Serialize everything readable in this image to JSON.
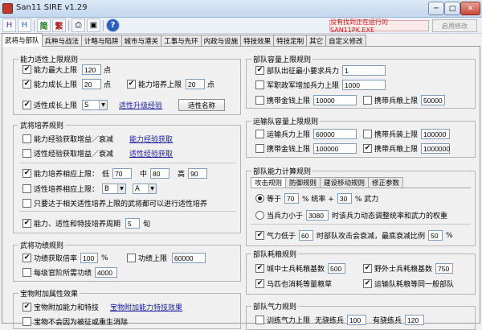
{
  "window": {
    "title": "San11 SIRE v1.29",
    "minimize": "─",
    "maximize": "□",
    "close": "✕"
  },
  "toolbar": {
    "buttons": [
      "H",
      "H",
      "简",
      "繁",
      "⎙",
      "▣",
      "?"
    ],
    "warning": "没有找到正在运行的SAN11PK.EXE",
    "apply_button": "启用修改"
  },
  "tabs": [
    "武将与部队",
    "兵种与战法",
    "计略与陷阱",
    "城市与港关",
    "工事与先环",
    "内政与设施",
    "特技效果",
    "特技定制",
    "其它",
    "自定义修改"
  ],
  "ability_upper": {
    "title": "能力适性上限规则",
    "max_upper_label": "能力最大上限",
    "max_upper_value": "120",
    "unit_pt": "点",
    "growth_upper_label": "能力成长上限",
    "growth_upper_value": "20",
    "train_upper_label": "能力培养上限",
    "train_upper_value": "20",
    "aptitude_growth_label": "适性成长上限",
    "aptitude_growth_value": "S",
    "aptitude_link": "适性升级经验",
    "aptitude_name_button": "适性名称"
  },
  "cultivation": {
    "title": "武将培养规则",
    "ability_exp_label": "能力经验获取增益／衰减",
    "ability_exp_link": "能力经验获取",
    "aptitude_exp_label": "适性经验获取增益／衰减",
    "aptitude_exp_link": "适性经验获取",
    "train_relate_label": "能力培养相应上限：",
    "low_label": "低",
    "low_value": "70",
    "mid_label": "中",
    "mid_value": "80",
    "high_label": "高",
    "high_value": "90",
    "aptitude_train_label": "适性培养相应上限：",
    "b_value": "B",
    "a_value": "A",
    "only_train_label": "只要达于相关适性培养上限的武将都可以进行适性培养",
    "period_label": "能力、适性和特技培养周期",
    "period_value": "5",
    "period_unit": "旬"
  },
  "merit": {
    "title": "武将功绩规则",
    "gain_label": "功绩获取倍率",
    "gain_value": "100",
    "percent": "%",
    "upper_label": "功绩上限",
    "upper_value": "60000",
    "loss_label": "每级官阶所需功绩",
    "loss_value": "4000"
  },
  "treasure": {
    "title": "宝物附加属性效果",
    "treasure_label": "宝物附加能力和特技",
    "treasure_link": "宝物附加能力特技效果",
    "treasure2_label": "宝物不会因为被征或重生消除"
  },
  "troop_capacity": {
    "title": "部队容量上限规则",
    "min_label": "部队出征最小要求兵力",
    "min_value": "1",
    "army_label": "军职政军增加兵力上限",
    "army_value": "1000",
    "gold_label": "携带金钱上限",
    "gold_value": "10000",
    "food_label": "携带兵粮上限",
    "food_value": "50000"
  },
  "transport_capacity": {
    "title": "运输队容量上限规则",
    "troop_label": "运输兵力上限",
    "troop_value": "60000",
    "weapon_label": "携带兵装上限",
    "weapon_value": "100000",
    "gold_label": "携带金钱上限",
    "gold_value": "100000",
    "food_label": "携带兵粮上限",
    "food_value": "1000000"
  },
  "troop_calc": {
    "title": "部队能力计算规则",
    "subtabs": [
      "攻击规则",
      "防御规则",
      "建设移动规则",
      "修正参数"
    ],
    "eq_label": "等于",
    "eq_value": "70",
    "eq_mid": "% 统率 +",
    "eq_value2": "30",
    "eq_tail": "% 武力",
    "lt_label": "当兵力小于",
    "lt_value": "3080",
    "lt_tail": "时该兵力动态调整统率和武力的权重",
    "morale_label": "气力低于",
    "morale_value": "60",
    "morale_mid": "时部队攻击会衰减，最底衰减比例",
    "morale_value2": "50",
    "percent": "%"
  },
  "troop_consume": {
    "title": "部队耗粮规则",
    "city_label": "城中士兵耗粮基数",
    "city_value": "500",
    "field_label": "野外士兵耗粮基数",
    "field_value": "750",
    "horse_label": "马匹也消耗等量粮草",
    "transport_label": "运输队耗粮等同一般部队"
  },
  "troop_morale": {
    "title": "部队气力规则",
    "train_label": "训练气力上限",
    "no_train_label": "无骁练兵",
    "no_train_value": "100",
    "has_train_label": "有骁练兵",
    "has_train_value": "120"
  },
  "colors": {
    "accent": "#c41c1c",
    "link": "#1b1b9c"
  }
}
